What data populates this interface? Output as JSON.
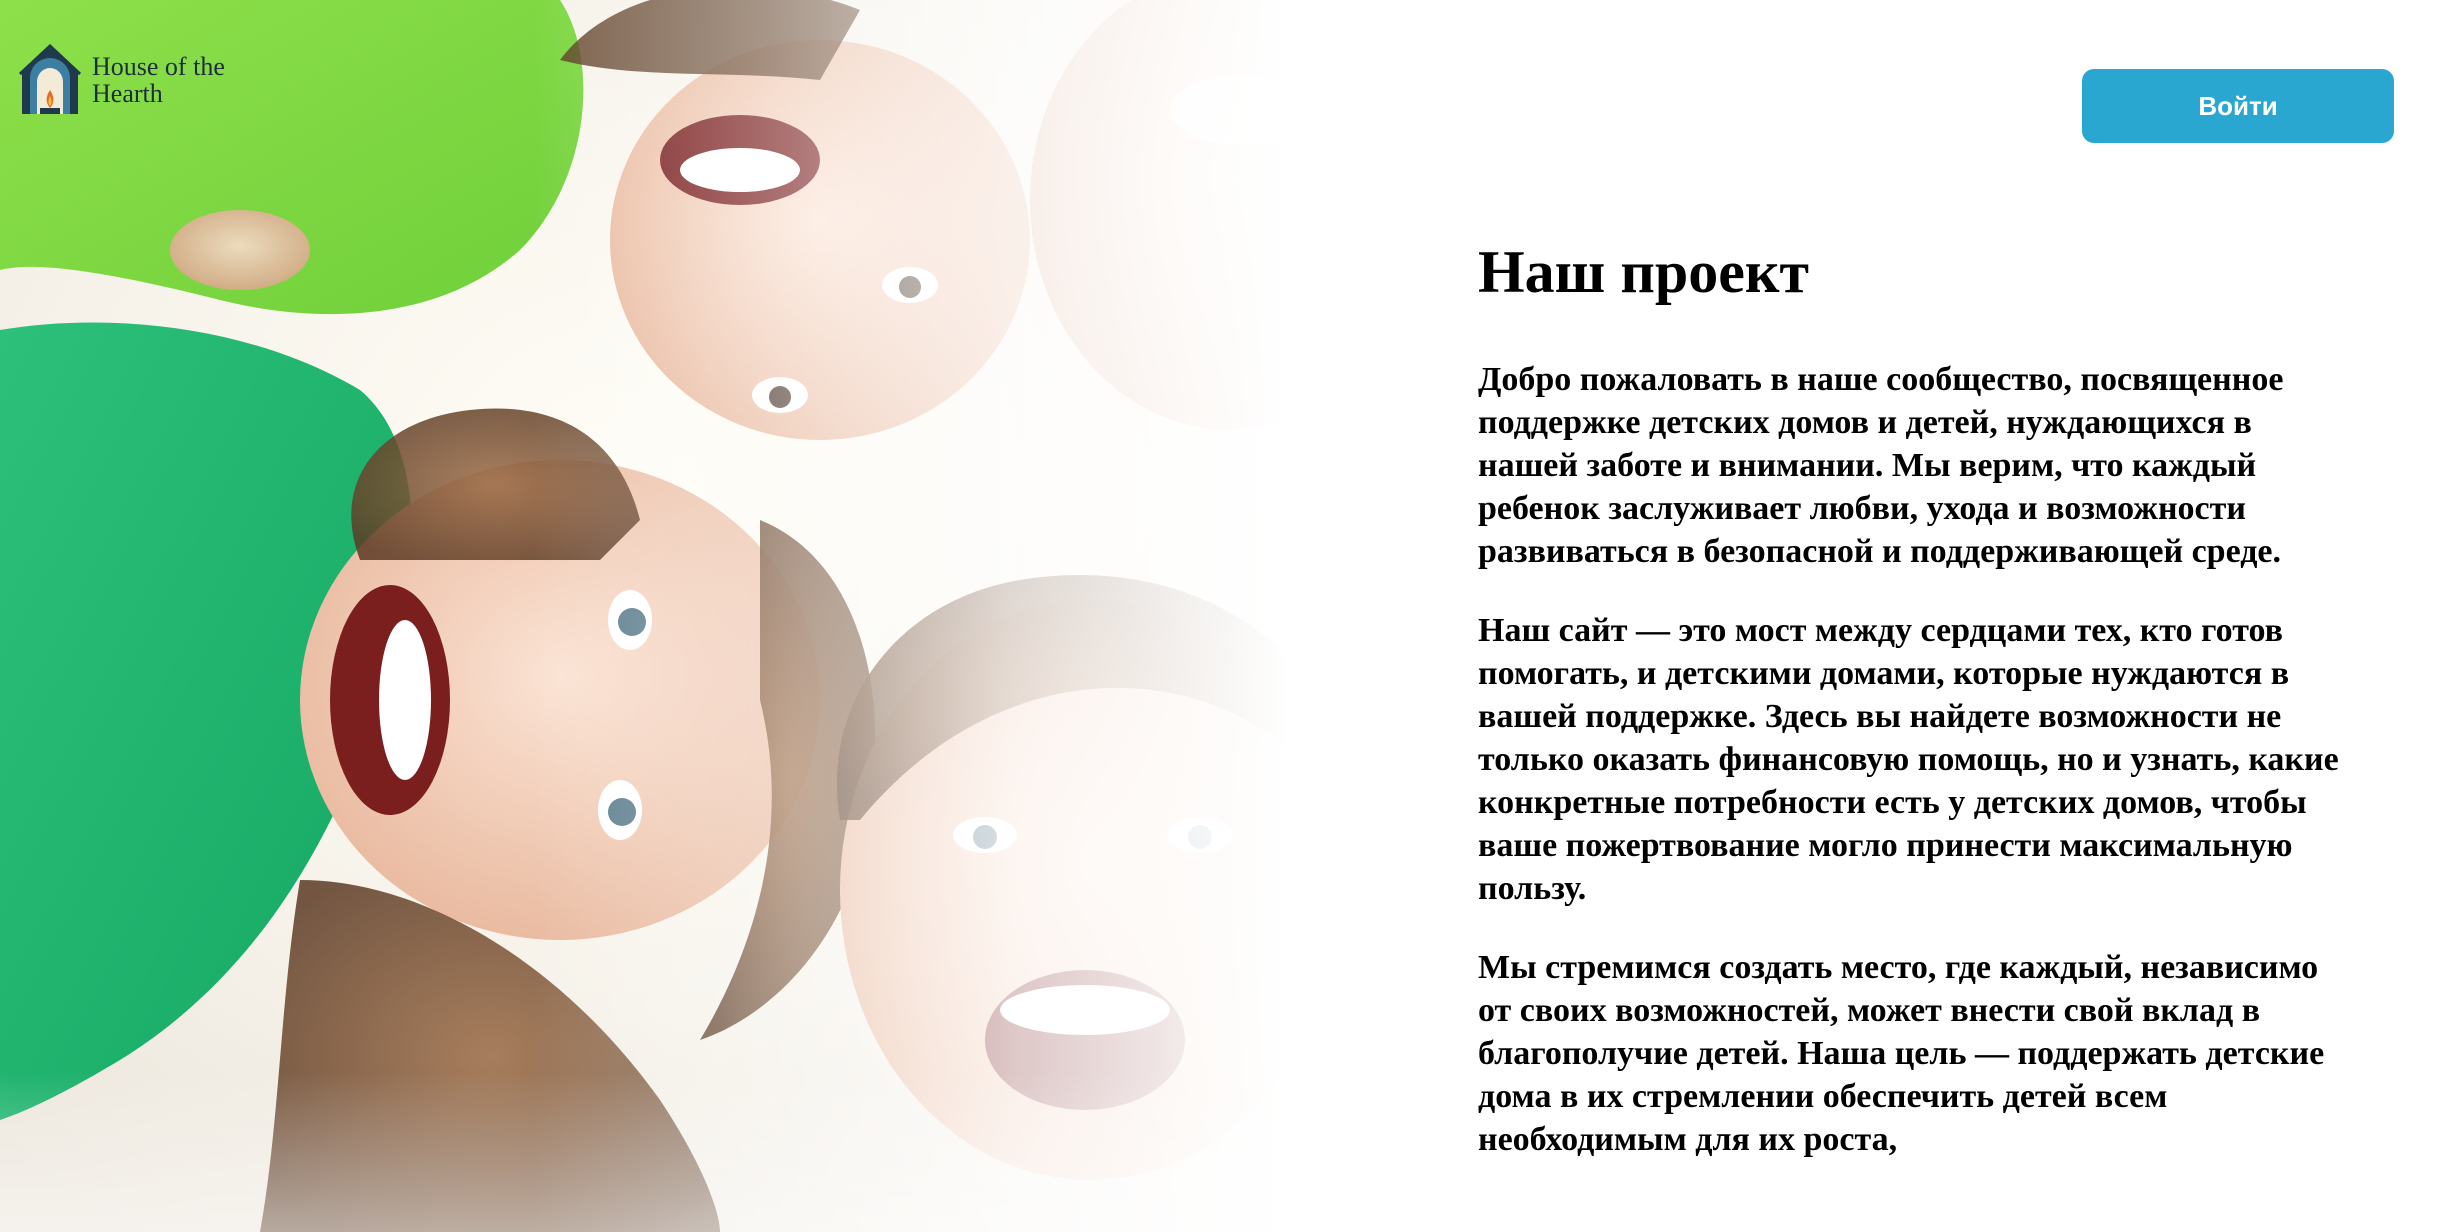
{
  "header": {
    "logo": {
      "icon": "house-hearth-logo-icon",
      "line1": "House of the",
      "line2": "Hearth"
    },
    "login_label": "Войти"
  },
  "hero": {
    "image": "smiling-children-photo"
  },
  "colors": {
    "accent": "#29a7d1",
    "text": "#000000",
    "background": "#ffffff"
  },
  "main": {
    "title": "Наш проект",
    "paragraphs": [
      "Добро пожаловать в наше сообщество, посвященное поддержке детских домов и детей, нуждающихся в нашей заботе и внимании. Мы верим, что каждый ребенок заслуживает любви, ухода и возможности развиваться в безопасной и поддерживающей среде.",
      "Наш сайт — это мост между сердцами тех, кто готов помогать, и детскими домами, которые нуждаются в вашей поддержке. Здесь вы найдете возможности не только оказать финансовую помощь, но и узнать, какие конкретные потребности есть у детских домов, чтобы ваше пожертвование могло принести максимальную пользу.",
      "Мы стремимся создать место, где каждый, независимо от своих возможностей, может внести свой вклад в благополучие детей. Наша цель — поддержать детские дома в их стремлении обеспечить детей всем необходимым для их роста,"
    ]
  }
}
